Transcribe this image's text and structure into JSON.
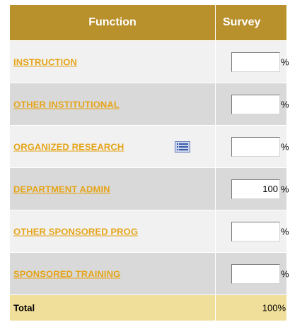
{
  "header": {
    "function_label": "Function",
    "survey_label": "Survey"
  },
  "rows": [
    {
      "label": "INSTRUCTION",
      "value": "",
      "unit": "%"
    },
    {
      "label": "OTHER INSTITUTIONAL",
      "value": "",
      "unit": "%"
    },
    {
      "label": "ORGANIZED RESEARCH",
      "value": "",
      "unit": "%",
      "icon": "list-icon"
    },
    {
      "label": "DEPARTMENT ADMIN",
      "value": "100",
      "unit": "%"
    },
    {
      "label": "OTHER SPONSORED PROG",
      "value": "",
      "unit": "%"
    },
    {
      "label": "SPONSORED TRAINING",
      "value": "",
      "unit": "%"
    }
  ],
  "total": {
    "label": "Total",
    "value": "100%"
  },
  "colors": {
    "header_bg": "#b8902c",
    "link": "#e5a51a",
    "row_light": "#f1f1f1",
    "row_dark": "#d9d9d9",
    "total_bg": "#f0df9a"
  }
}
